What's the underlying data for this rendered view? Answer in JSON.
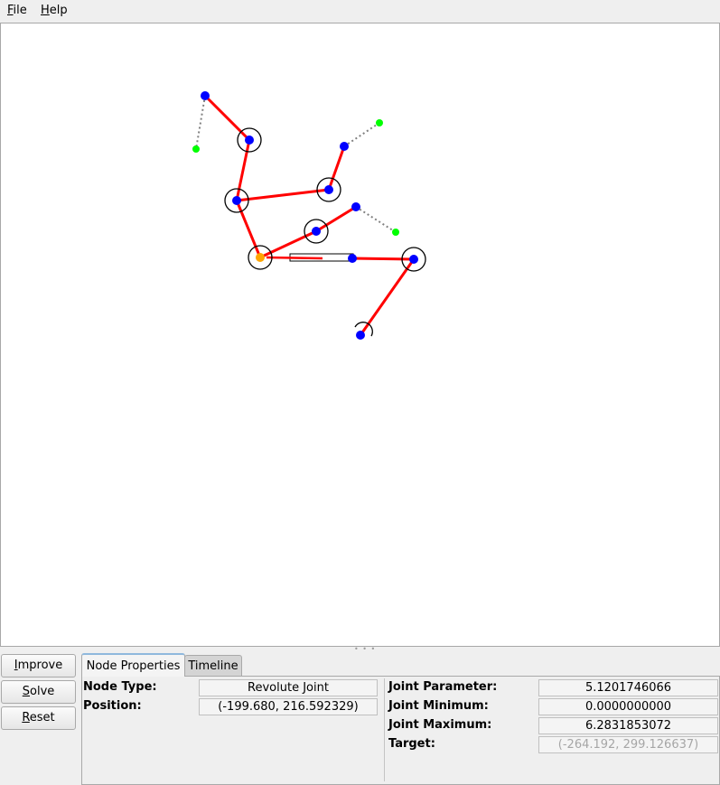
{
  "menubar": {
    "file": {
      "accel": "F",
      "rest": "ile"
    },
    "help": {
      "accel": "H",
      "rest": "elp"
    }
  },
  "buttons": {
    "improve": {
      "accel": "I",
      "rest": "mprove"
    },
    "solve": {
      "accel": "S",
      "rest": "olve"
    },
    "reset": {
      "accel": "R",
      "rest": "eset"
    }
  },
  "tabs": {
    "node_properties": "Node Properties",
    "timeline": "Timeline"
  },
  "properties": {
    "node_type_label": "Node Type:",
    "node_type_value": "Revolute Joint",
    "position_label": "Position:",
    "position_value": "(-199.680, 216.592329)",
    "joint_parameter_label": "Joint Parameter:",
    "joint_parameter_value": "5.1201746066",
    "joint_minimum_label": "Joint Minimum:",
    "joint_minimum_value": "0.0000000000",
    "joint_maximum_label": "Joint Maximum:",
    "joint_maximum_value": "6.2831853072",
    "target_label": "Target:",
    "target_value": "(-264.192, 299.126637)"
  },
  "colors": {
    "link": "#ff0000",
    "joint_node": "#0000ff",
    "selected_node": "#ffa500",
    "target_node": "#00ff00",
    "target_line": "#808080"
  }
}
